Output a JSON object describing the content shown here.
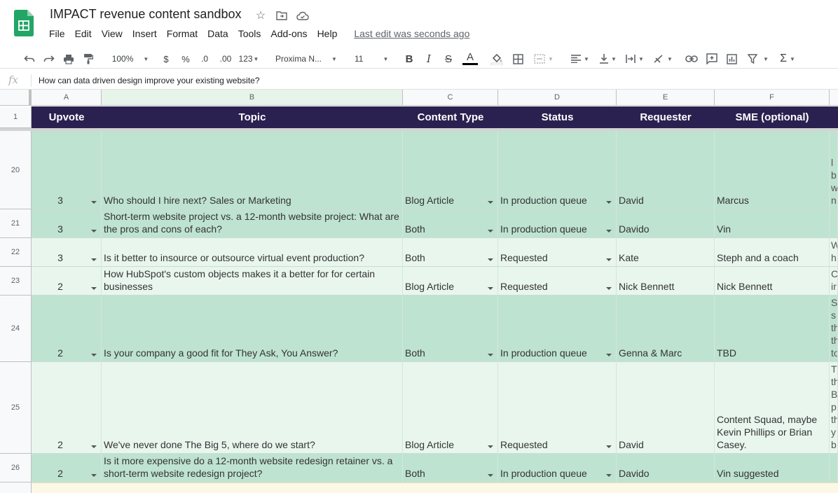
{
  "app": {
    "title": "IMPACT revenue content sandbox",
    "menu": [
      "File",
      "Edit",
      "View",
      "Insert",
      "Format",
      "Data",
      "Tools",
      "Add-ons",
      "Help"
    ],
    "last_edit": "Last edit was seconds ago"
  },
  "toolbar": {
    "zoom": "100%",
    "currency": "$",
    "percent": "%",
    "dec_decrease": ".0",
    "dec_increase": ".00",
    "number_format": "123",
    "font": "Proxima N...",
    "font_size": "11",
    "bold": "B",
    "italic": "I",
    "strike": "S",
    "text_color": "A"
  },
  "formula_bar": {
    "fx": "fx",
    "content": "How can data driven design improve your existing website?"
  },
  "columns": [
    "A",
    "B",
    "C",
    "D",
    "E",
    "F"
  ],
  "header_row": {
    "row_number": "1",
    "cells": [
      "Upvote",
      "Topic",
      "Content Type",
      "Status",
      "Requester",
      "SME (optional)"
    ]
  },
  "rows": [
    {
      "num": "20",
      "upvote": "3",
      "topic": "Who should I hire next? Sales or Marketing",
      "type": "Blog Article",
      "status": "In production queue",
      "requester": "David",
      "sme": "Marcus",
      "next": "l\nb\nw\nn"
    },
    {
      "num": "21",
      "upvote": "3",
      "topic": "Short-term website project vs. a 12-month website project: What are the pros and cons of each?",
      "type": "Both",
      "status": "In production queue",
      "requester": "Davido",
      "sme": "Vin",
      "next": ""
    },
    {
      "num": "22",
      "upvote": "3",
      "topic": "Is it better to insource or outsource virtual event production?",
      "type": "Both",
      "status": "Requested",
      "requester": "Kate",
      "sme": "Steph and a coach",
      "next": "W\nh"
    },
    {
      "num": "23",
      "upvote": "2",
      "topic": "How HubSpot's custom objects makes it a better for for certain businesses",
      "type": "Blog Article",
      "status": "Requested",
      "requester": "Nick Bennett",
      "sme": "Nick Bennett",
      "next": "C\nir"
    },
    {
      "num": "24",
      "upvote": "2",
      "topic": "Is your company a good fit for They Ask, You Answer?",
      "type": "Both",
      "status": "In production queue",
      "requester": "Genna & Marc",
      "sme": "TBD",
      "next": "S\ns\nth\nth\nto"
    },
    {
      "num": "25",
      "upvote": "2",
      "topic": "We've never done The Big 5, where do we start?",
      "type": "Blog Article",
      "status": "Requested",
      "requester": "David",
      "sme": "Content Squad, maybe Kevin Phillips or Brian Casey.",
      "next": "T\nth\nB\np\nth\ny\nb"
    },
    {
      "num": "26",
      "upvote": "2",
      "topic": "Is it more expensive do a 12-month website redesign retainer vs. a short-term website redesign project?",
      "type": "Both",
      "status": "In production queue",
      "requester": "Davido",
      "sme": "Vin suggested",
      "next": ""
    }
  ],
  "colors": {
    "header_bg": "#2b2150",
    "row_dark": "#bfe3d1",
    "row_light": "#e9f6ee",
    "sheets_green": "#23a566"
  }
}
